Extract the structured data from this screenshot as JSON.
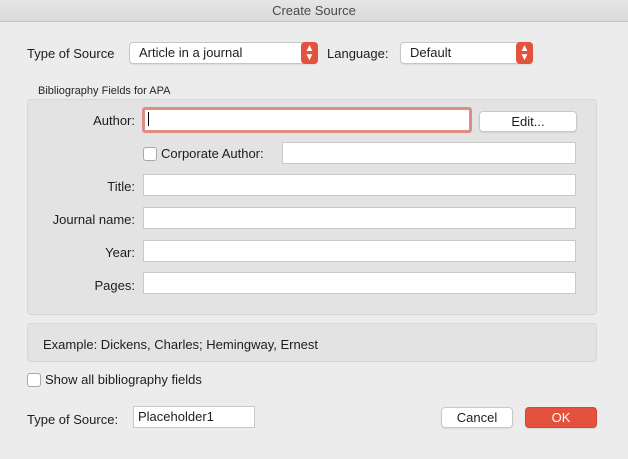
{
  "window": {
    "title": "Create Source"
  },
  "top_bar": {
    "type_label": "Type of Source",
    "type_value": "Article in a journal",
    "language_label": "Language:",
    "language_value": "Default"
  },
  "fields_section": {
    "title": "Bibliography Fields for APA",
    "author_label": "Author:",
    "author_value": "",
    "edit_button": "Edit...",
    "corporate_author_label": "Corporate Author:",
    "corporate_author_value": "",
    "title_label": "Title:",
    "title_value": "",
    "journal_label": "Journal name:",
    "journal_value": "",
    "year_label": "Year:",
    "year_value": "",
    "pages_label": "Pages:",
    "pages_value": ""
  },
  "example_text": "Example: Dickens, Charles; Hemingway, Ernest",
  "show_all_label": "Show all bibliography fields",
  "bottom": {
    "tag_label": "Type of Source:",
    "tag_value": "Placeholder1",
    "cancel_button": "Cancel",
    "ok_button": "OK"
  },
  "colors": {
    "accent": "#e4513c",
    "focus_ring": "#df8e82",
    "background": "#ececec",
    "group_background": "#e3e3e3"
  },
  "icons": {
    "popup_arrows": "up-down-chevron-icon",
    "checkbox": "checkbox-unchecked"
  }
}
